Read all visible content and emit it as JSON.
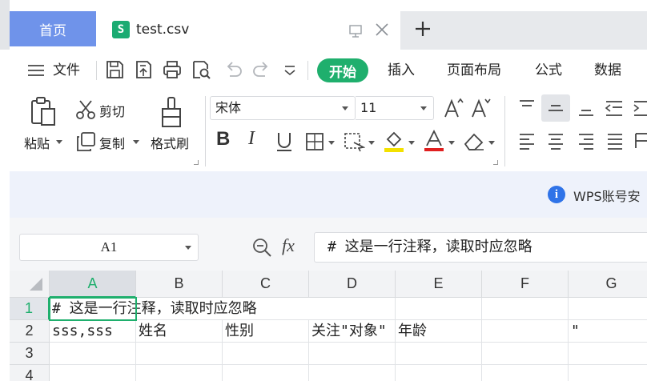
{
  "tabs": {
    "home_label": "首页",
    "file_icon_letter": "S",
    "file_name": "test.csv"
  },
  "menu": {
    "file_label": "文件",
    "items": [
      "开始",
      "插入",
      "页面布局",
      "公式",
      "数据"
    ]
  },
  "ribbon": {
    "paste_label": "粘贴",
    "cut_label": "剪切",
    "copy_label": "复制",
    "format_painter_label": "格式刷",
    "font_name": "宋体",
    "font_size": "11"
  },
  "banner": {
    "text": "WPS账号安"
  },
  "formula_bar": {
    "cell_ref": "A1",
    "fx_label": "fx",
    "content": "# 这是一行注释，读取时应忽略"
  },
  "grid": {
    "columns": [
      "A",
      "B",
      "C",
      "D",
      "E",
      "F",
      "G"
    ],
    "active_column": "A",
    "rows": [
      "1",
      "2",
      "3",
      "4"
    ],
    "active_row": "1",
    "row1_text": "# 这是一行注释，读取时应忽略",
    "row2_cells": [
      "sss,sss",
      "姓名",
      "性别",
      "关注\"对象\"",
      "年龄",
      "",
      "\""
    ]
  },
  "colors": {
    "accent": "#1faf6d",
    "home_tab": "#6f93ea",
    "info_blue": "#2f73e8"
  }
}
